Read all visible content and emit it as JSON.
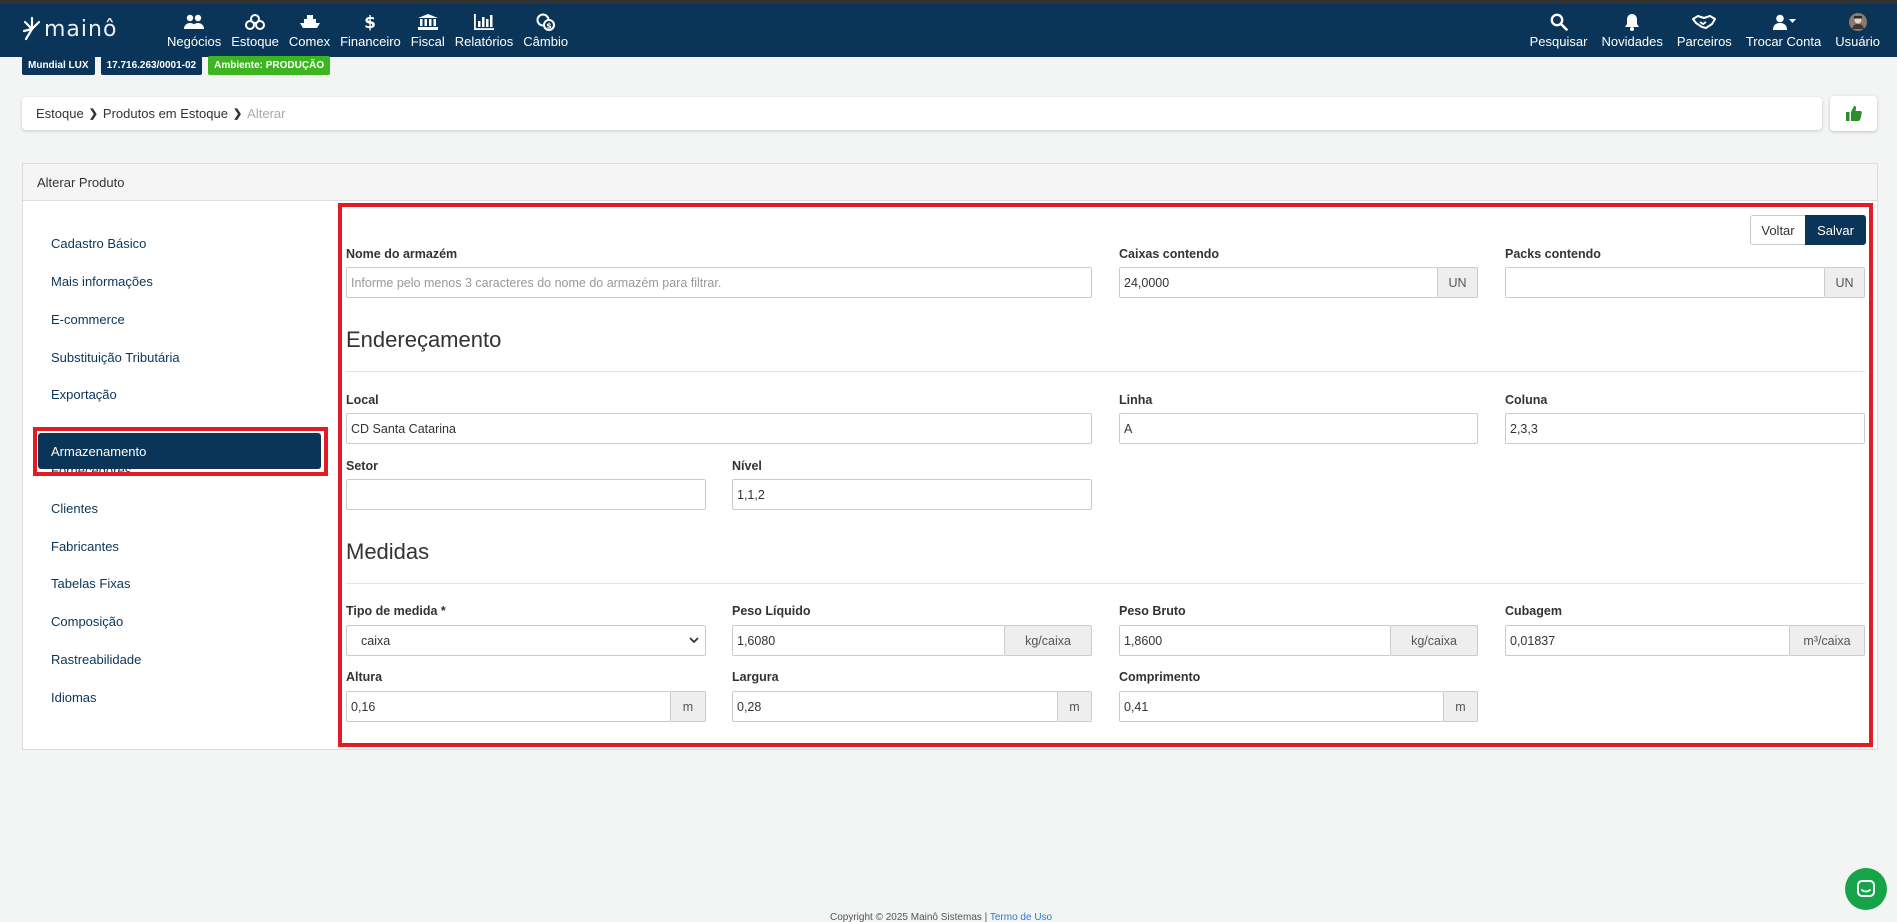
{
  "brand": {
    "logo_text": "mainô"
  },
  "nav": {
    "left": [
      {
        "label": "Negócios",
        "icon": "users-icon"
      },
      {
        "label": "Estoque",
        "icon": "boxes-icon"
      },
      {
        "label": "Comex",
        "icon": "ship-icon"
      },
      {
        "label": "Financeiro",
        "icon": "dollar-icon"
      },
      {
        "label": "Fiscal",
        "icon": "bank-icon"
      },
      {
        "label": "Relatórios",
        "icon": "bar-chart-icon"
      },
      {
        "label": "Câmbio",
        "icon": "coins-icon"
      }
    ],
    "right": [
      {
        "label": "Pesquisar",
        "icon": "search-icon"
      },
      {
        "label": "Novidades",
        "icon": "bell-icon"
      },
      {
        "label": "Parceiros",
        "icon": "handshake-icon"
      },
      {
        "label": "Trocar Conta",
        "icon": "user-switch-icon"
      },
      {
        "label": "Usuário",
        "icon": "avatar-icon"
      }
    ]
  },
  "badges": {
    "company": "Mundial LUX",
    "cnpj": "17.716.263/0001-02",
    "environment": "Ambiente: PRODUÇÃO"
  },
  "breadcrumb": {
    "items": [
      "Estoque",
      "Produtos em Estoque",
      "Alterar"
    ]
  },
  "panel": {
    "title": "Alterar Produto"
  },
  "sidebar": {
    "items": [
      "Cadastro Básico",
      "Mais informações",
      "E-commerce",
      "Substituição Tributária",
      "Exportação",
      "Armazenamento",
      "Fornecedores",
      "Clientes",
      "Fabricantes",
      "Tabelas Fixas",
      "Composição",
      "Rastreabilidade",
      "Idiomas"
    ],
    "active": "Armazenamento"
  },
  "actions": {
    "back": "Voltar",
    "save": "Salvar"
  },
  "form": {
    "armazem": {
      "label": "Nome do armazém",
      "placeholder": "Informe pelo menos 3 caracteres do nome do armazém para filtrar."
    },
    "caixas": {
      "label": "Caixas contendo",
      "value": "24,0000",
      "unit": "UN"
    },
    "packs": {
      "label": "Packs contendo",
      "value": "",
      "unit": "UN"
    },
    "enderecamento_title": "Endereçamento",
    "local": {
      "label": "Local",
      "value": "CD Santa Catarina"
    },
    "linha": {
      "label": "Linha",
      "value": "A"
    },
    "coluna": {
      "label": "Coluna",
      "value": "2,3,3"
    },
    "setor": {
      "label": "Setor",
      "value": ""
    },
    "nivel": {
      "label": "Nível",
      "value": "1,1,2"
    },
    "medidas_title": "Medidas",
    "tipo_medida": {
      "label": "Tipo de medida *",
      "value": "caixa"
    },
    "peso_liquido": {
      "label": "Peso Líquido",
      "value": "1,6080",
      "unit": "kg/caixa"
    },
    "peso_bruto": {
      "label": "Peso Bruto",
      "value": "1,8600",
      "unit": "kg/caixa"
    },
    "cubagem": {
      "label": "Cubagem",
      "value": "0,01837",
      "unit": "m³/caixa"
    },
    "altura": {
      "label": "Altura",
      "value": "0,16",
      "unit": "m"
    },
    "largura": {
      "label": "Largura",
      "value": "0,28",
      "unit": "m"
    },
    "comprimento": {
      "label": "Comprimento",
      "value": "0,41",
      "unit": "m"
    }
  },
  "footer": {
    "text": "Copyright © 2025 Mainô Sistemas | ",
    "link": "Termo de Uso"
  },
  "colors": {
    "navy": "#0a3559",
    "green": "#3cb521",
    "highlight": "#e11c24",
    "chat": "#17a34a"
  }
}
